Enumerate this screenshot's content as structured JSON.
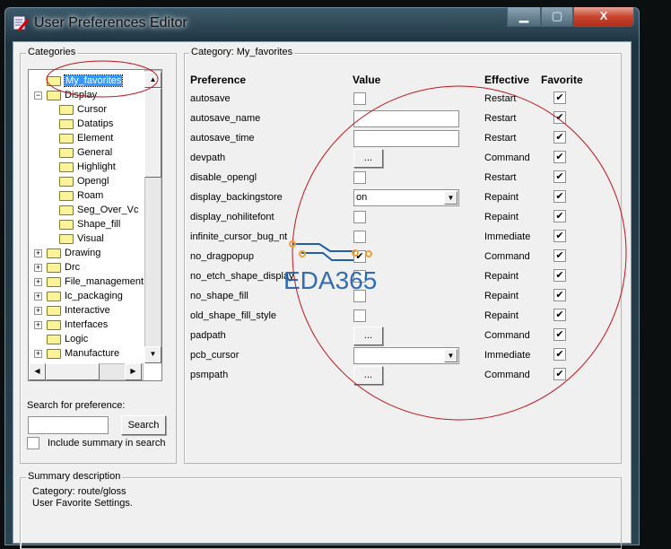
{
  "window": {
    "title": "User Preferences Editor",
    "minimize": "▁",
    "maximize": "▢",
    "close": "X"
  },
  "categories": {
    "label": "Categories",
    "items": [
      {
        "label": "My_favorites",
        "level": 0,
        "expander": "",
        "selected": true
      },
      {
        "label": "Display",
        "level": 0,
        "expander": "−"
      },
      {
        "label": "Cursor",
        "level": 1
      },
      {
        "label": "Datatips",
        "level": 1
      },
      {
        "label": "Element",
        "level": 1
      },
      {
        "label": "General",
        "level": 1
      },
      {
        "label": "Highlight",
        "level": 1
      },
      {
        "label": "Opengl",
        "level": 1
      },
      {
        "label": "Roam",
        "level": 1
      },
      {
        "label": "Seg_Over_Vc",
        "level": 1
      },
      {
        "label": "Shape_fill",
        "level": 1
      },
      {
        "label": "Visual",
        "level": 1
      },
      {
        "label": "Drawing",
        "level": 0,
        "expander": "+"
      },
      {
        "label": "Drc",
        "level": 0,
        "expander": "+"
      },
      {
        "label": "File_management",
        "level": 0,
        "expander": "+"
      },
      {
        "label": "Ic_packaging",
        "level": 0,
        "expander": "+"
      },
      {
        "label": "Interactive",
        "level": 0,
        "expander": "+"
      },
      {
        "label": "Interfaces",
        "level": 0,
        "expander": "+"
      },
      {
        "label": "Logic",
        "level": 0,
        "expander": ""
      },
      {
        "label": "Manufacture",
        "level": 0,
        "expander": "+"
      }
    ]
  },
  "search": {
    "label": "Search for preference:",
    "value": "",
    "button": "Search",
    "include_summary_label": "Include summary in search",
    "include_summary_checked": false
  },
  "category_panel": {
    "label": "Category:  My_favorites",
    "columns": {
      "preference": "Preference",
      "value": "Value",
      "effective": "Effective",
      "favorite": "Favorite"
    },
    "rows": [
      {
        "name": "autosave",
        "type": "checkbox",
        "checked": false,
        "effective": "Restart",
        "favorite": true
      },
      {
        "name": "autosave_name",
        "type": "text",
        "value": "",
        "effective": "Restart",
        "favorite": true
      },
      {
        "name": "autosave_time",
        "type": "text",
        "value": "",
        "effective": "Restart",
        "favorite": true
      },
      {
        "name": "devpath",
        "type": "button",
        "value": "...",
        "effective": "Command",
        "favorite": true
      },
      {
        "name": "disable_opengl",
        "type": "checkbox",
        "checked": false,
        "effective": "Restart",
        "favorite": true
      },
      {
        "name": "display_backingstore",
        "type": "select",
        "value": "on",
        "effective": "Repaint",
        "favorite": true
      },
      {
        "name": "display_nohilitefont",
        "type": "checkbox",
        "checked": false,
        "effective": "Repaint",
        "favorite": true
      },
      {
        "name": "infinite_cursor_bug_nt",
        "type": "checkbox",
        "checked": false,
        "effective": "Immediate",
        "favorite": true
      },
      {
        "name": "no_dragpopup",
        "type": "checkbox",
        "checked": true,
        "effective": "Command",
        "favorite": true
      },
      {
        "name": "no_etch_shape_display",
        "type": "checkbox",
        "checked": false,
        "effective": "Repaint",
        "favorite": true
      },
      {
        "name": "no_shape_fill",
        "type": "checkbox",
        "checked": false,
        "effective": "Repaint",
        "favorite": true
      },
      {
        "name": "old_shape_fill_style",
        "type": "checkbox",
        "checked": false,
        "effective": "Repaint",
        "favorite": true
      },
      {
        "name": "padpath",
        "type": "button",
        "value": "...",
        "effective": "Command",
        "favorite": true
      },
      {
        "name": "pcb_cursor",
        "type": "select",
        "value": "",
        "effective": "Immediate",
        "favorite": true
      },
      {
        "name": "psmpath",
        "type": "button",
        "value": "...",
        "effective": "Command",
        "favorite": true
      }
    ]
  },
  "summary": {
    "label": "Summary description",
    "lines": [
      "Category: route/gloss",
      "User Favorite Settings."
    ]
  },
  "watermark": "EDA365",
  "colors": {
    "selection": "#3399ff",
    "annotation": "#c0141c",
    "watermark": "#1d5fa8"
  }
}
